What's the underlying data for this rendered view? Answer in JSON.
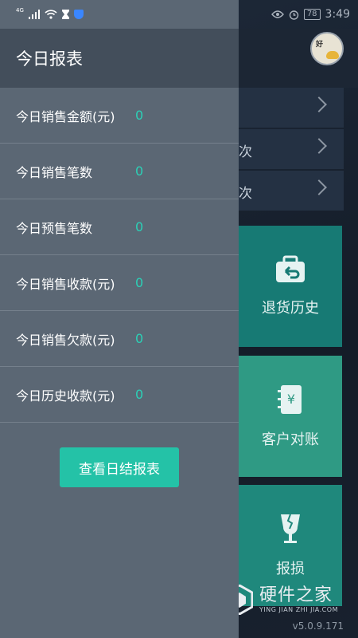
{
  "status_bar": {
    "network": "4G",
    "battery": "78",
    "time": "3:49"
  },
  "drawer": {
    "title": "今日报表",
    "items": [
      {
        "label": "今日销售金额(元)",
        "value": "0"
      },
      {
        "label": "今日销售笔数",
        "value": "0"
      },
      {
        "label": "今日预售笔数",
        "value": "0"
      },
      {
        "label": "今日销售收款(元)",
        "value": "0"
      },
      {
        "label": "今日销售欠款(元)",
        "value": "0"
      },
      {
        "label": "今日历史收款(元)",
        "value": "0"
      }
    ],
    "button_label": "查看日结报表"
  },
  "background": {
    "rows": [
      {
        "suffix": ""
      },
      {
        "suffix": "次"
      },
      {
        "suffix": "次"
      }
    ],
    "tiles": [
      {
        "label": "退货历史",
        "icon": "return-bag-icon"
      },
      {
        "label": "客户对账",
        "icon": "statement-icon"
      },
      {
        "label": "报损",
        "icon": "broken-glass-icon"
      }
    ],
    "version": "v5.0.9.171"
  },
  "watermark": {
    "cn": "硬件之家",
    "en": "YING JIAN ZHI JIA.COM"
  },
  "colors": {
    "drawer_bg": "#5b6774",
    "drawer_header": "#434e5b",
    "accent": "#24c2a7",
    "value_text": "#2bd1b7"
  }
}
